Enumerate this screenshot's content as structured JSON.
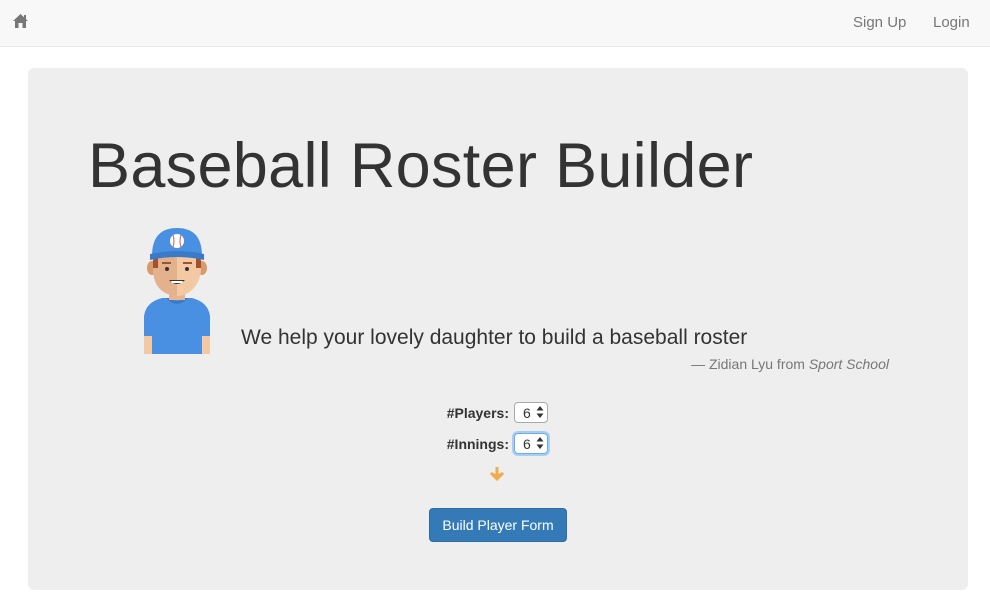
{
  "navbar": {
    "home_icon": "home-icon",
    "signup_label": "Sign Up",
    "login_label": "Login"
  },
  "main": {
    "title": "Baseball Roster Builder",
    "avatar_icon": "baseball-player-icon",
    "quote": {
      "text": "We help your lovely daughter to build a baseball roster",
      "author": "— Zidian Lyu from",
      "source": "Sport School"
    },
    "form": {
      "players_label": "#Players:",
      "players_value": "6",
      "innings_label": "#Innings:",
      "innings_value": "6",
      "arrow_icon": "arrow-down-icon",
      "submit_label": "Build Player Form"
    }
  },
  "colors": {
    "navbar_bg": "#f8f8f8",
    "jumbotron_bg": "#eeeeee",
    "primary_button": "#337ab7",
    "arrow": "#f0ad4e",
    "avatar_shirt": "#4a90e2"
  }
}
